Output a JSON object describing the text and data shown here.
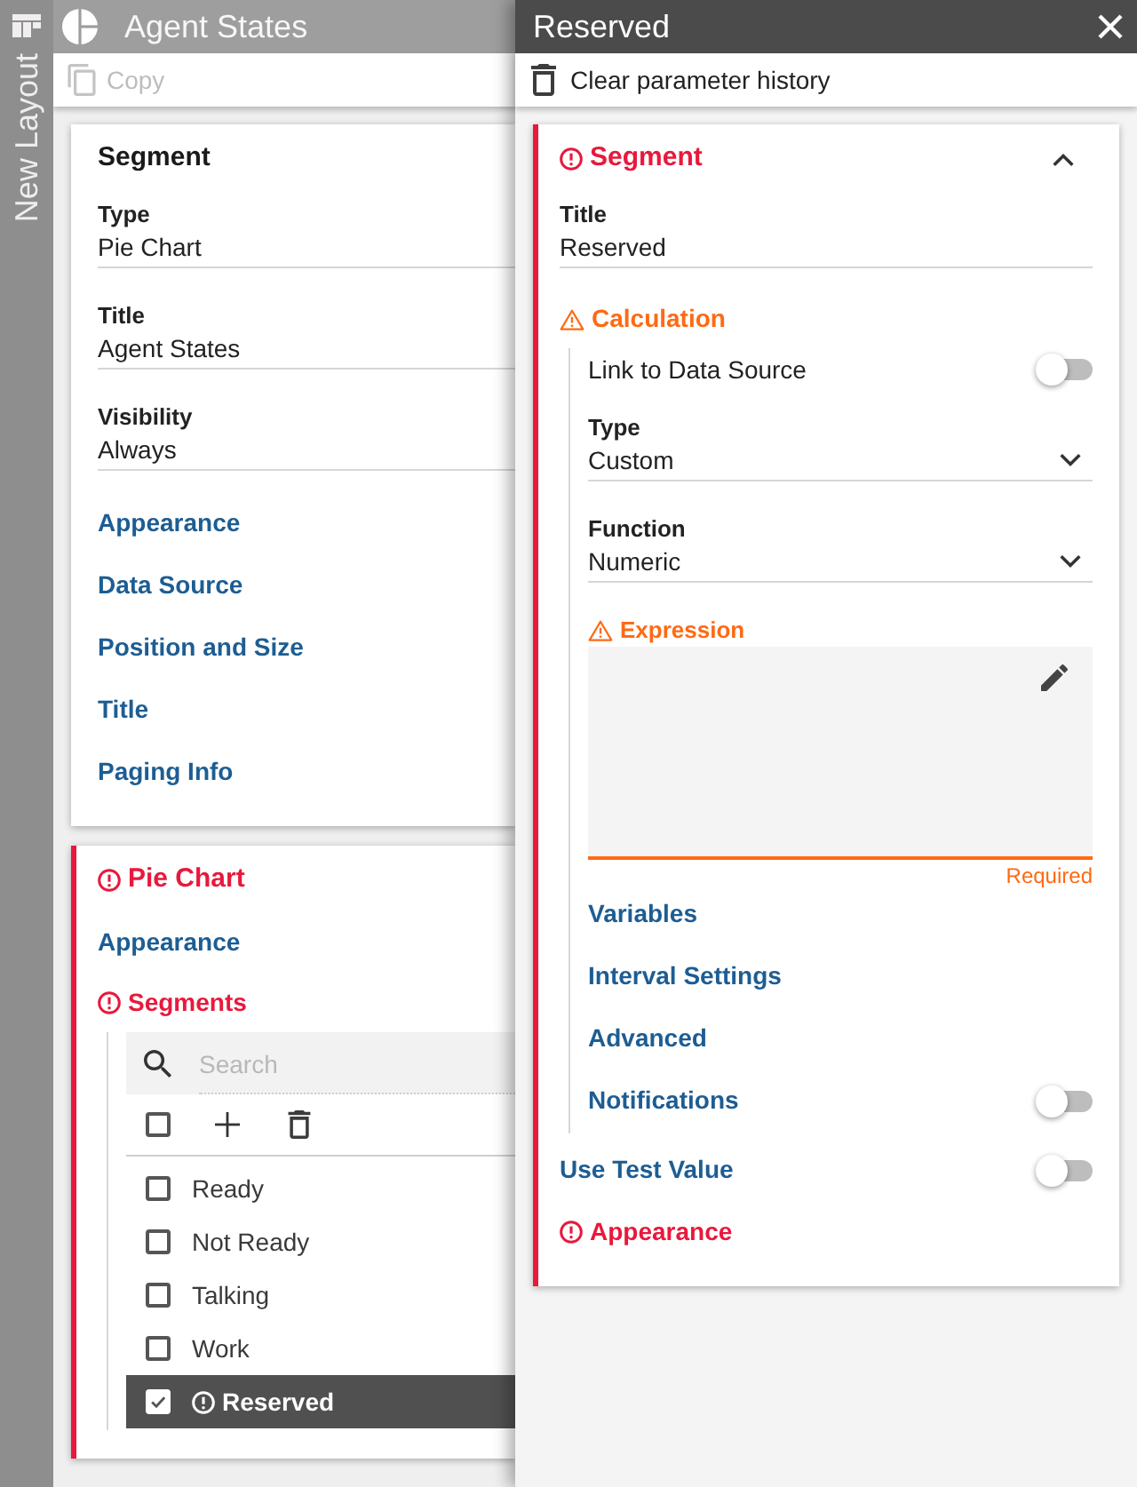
{
  "sidebar": {
    "label": "New Layout"
  },
  "left_panel": {
    "title": "Agent States",
    "toolbar": [
      {
        "label": "Copy",
        "disabled": true
      }
    ],
    "cards": [
      {
        "title": "Segment",
        "error": false,
        "rows": [
          {
            "kind": "field",
            "label": "Type",
            "value": "Pie Chart"
          },
          {
            "kind": "field",
            "label": "Title",
            "value": "Agent States"
          },
          {
            "kind": "field",
            "label": "Visibility",
            "value": "Always"
          },
          {
            "kind": "section",
            "label": "Appearance",
            "error": false,
            "warning": false
          },
          {
            "kind": "section",
            "label": "Data Source",
            "error": false,
            "warning": false
          },
          {
            "kind": "section",
            "label": "Position and Size",
            "error": false,
            "warning": false
          },
          {
            "kind": "section",
            "label": "Title",
            "error": false,
            "warning": false
          },
          {
            "kind": "section",
            "label": "Paging Info",
            "error": false,
            "warning": false
          }
        ]
      },
      {
        "title": "Pie Chart",
        "error": true,
        "rows": [
          {
            "kind": "section",
            "label": "Appearance",
            "error": false,
            "warning": false
          },
          {
            "kind": "group",
            "label": "Segments",
            "error": true,
            "warning": false,
            "children": [
              {
                "kind": "list",
                "search": {
                  "placeholder": "Search"
                },
                "select_all": {
                  "checked": false
                },
                "items": [
                  {
                    "label": "Ready",
                    "checked": false,
                    "selected": false,
                    "error": false
                  },
                  {
                    "label": "Not Ready",
                    "checked": false,
                    "selected": false,
                    "error": false
                  },
                  {
                    "label": "Talking",
                    "checked": false,
                    "selected": false,
                    "error": false
                  },
                  {
                    "label": "Work",
                    "checked": false,
                    "selected": false,
                    "error": false
                  },
                  {
                    "label": "Reserved",
                    "checked": true,
                    "selected": true,
                    "error": true
                  }
                ]
              }
            ]
          }
        ]
      }
    ]
  },
  "right_panel": {
    "title": "Reserved",
    "toolbar": [
      {
        "label": "Clear parameter history",
        "disabled": false
      }
    ],
    "cards": [
      {
        "title": "Segment",
        "error": true,
        "expanded": true,
        "rows": [
          {
            "kind": "field",
            "label": "Title",
            "value": "Reserved"
          },
          {
            "kind": "group",
            "label": "Calculation",
            "error": false,
            "warning": true,
            "children": [
              {
                "kind": "switch",
                "label": "Link to Data Source",
                "on": false
              },
              {
                "kind": "select",
                "label": "Type",
                "value": "Custom"
              },
              {
                "kind": "select",
                "label": "Function",
                "value": "Numeric"
              },
              {
                "kind": "textarea",
                "label": "Expression",
                "error": false,
                "warning": true,
                "helper": "Required"
              },
              {
                "kind": "section",
                "label": "Variables",
                "error": false,
                "warning": false
              },
              {
                "kind": "section",
                "label": "Interval Settings",
                "error": false,
                "warning": false
              },
              {
                "kind": "section",
                "label": "Advanced",
                "error": false,
                "warning": false
              },
              {
                "kind": "section",
                "label": "Notifications",
                "error": false,
                "warning": false,
                "on": false
              }
            ]
          },
          {
            "kind": "section",
            "label": "Use Test Value",
            "error": false,
            "warning": false,
            "on": false
          },
          {
            "kind": "section",
            "label": "Appearance",
            "error": true,
            "warning": false
          }
        ]
      }
    ]
  }
}
